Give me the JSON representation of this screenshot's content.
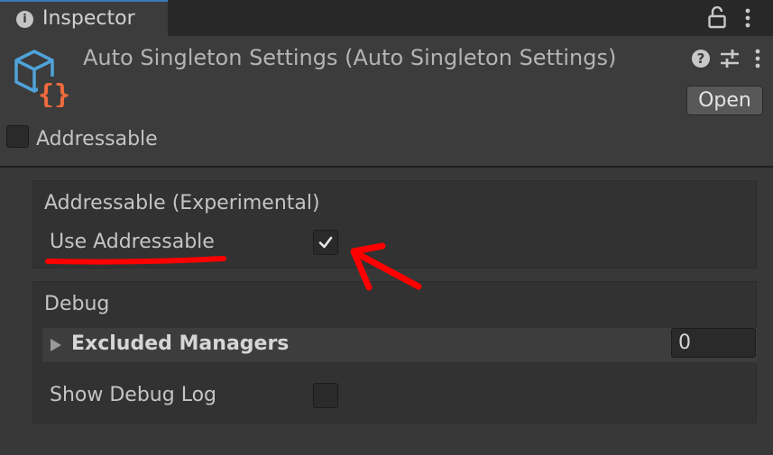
{
  "tab": {
    "label": "Inspector",
    "icon": "info-icon"
  },
  "toolbar": {
    "lock_icon": "lock-icon",
    "menu_icon": "kebab-menu-icon"
  },
  "header": {
    "title": "Auto Singleton Settings (Auto Singleton Settings)",
    "icon": "scriptable-object-icon",
    "help_icon": "help-icon",
    "preset_icon": "preset-sliders-icon",
    "open_label": "Open",
    "addressable_label": "Addressable",
    "addressable_checked": false
  },
  "addressable_section": {
    "title": "Addressable (Experimental)",
    "use_addressable_label": "Use Addressable",
    "use_addressable_checked": true
  },
  "debug_section": {
    "title": "Debug",
    "excluded_managers_label": "Excluded Managers",
    "excluded_managers_count": "0",
    "show_debug_log_label": "Show Debug Log",
    "show_debug_log_checked": false
  },
  "colors": {
    "background": "#383838",
    "tab_accent": "#3a79bb",
    "annotation_red": "#ff0000",
    "icon_blue": "#4fa3d9",
    "icon_orange": "#ef6a3c"
  }
}
